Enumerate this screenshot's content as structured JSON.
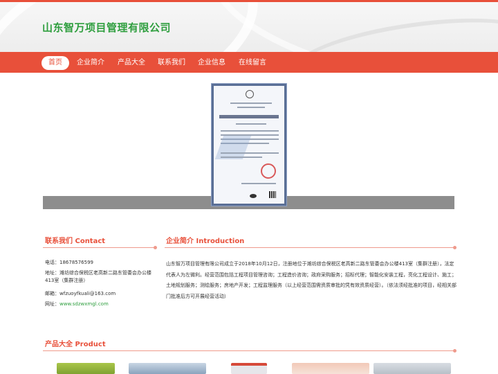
{
  "site": {
    "title": "山东智万项目管理有限公司"
  },
  "nav": {
    "items": [
      {
        "label": "首页",
        "active": true
      },
      {
        "label": "企业简介",
        "active": false
      },
      {
        "label": "产品大全",
        "active": false
      },
      {
        "label": "联系我们",
        "active": false
      },
      {
        "label": "企业信息",
        "active": false
      },
      {
        "label": "在线留言",
        "active": false
      }
    ]
  },
  "banner": {
    "image": "certificate-image"
  },
  "contact": {
    "heading": "联系我们 Contact",
    "phone": "电话：18678576599",
    "address": "地址：潍坊综合保税区老高新二路东管委会办公楼413室（集群注册）",
    "email": "邮箱：wfzuoyfkuali@163.com",
    "website_label": "网址：",
    "website": "www.sdzwxmgl.com"
  },
  "intro": {
    "heading": "企业简介 Introduction",
    "text": "山东智万项目管理有限公司成立于2018年10月12日，注册地位于潍坊综合保税区老高新二路东管委会办公楼413室（集群注册），法定代表人为左微利。经营范围包括工程项目管理咨询；工程造价咨询；政府采购服务；招标代理；智能化安装工程，亮化工程设计、施工；土地规划服务；测绘服务；房地产开发；工程监理服务（以上经营范围需资质审批的凭有效资质经营）。（依法须经批准的项目，经相关部门批准后方可开展经营活动）"
  },
  "products": {
    "heading": "产品大全 Product"
  },
  "colors": {
    "accent": "#e8503a",
    "brand": "#2e9e3e"
  }
}
